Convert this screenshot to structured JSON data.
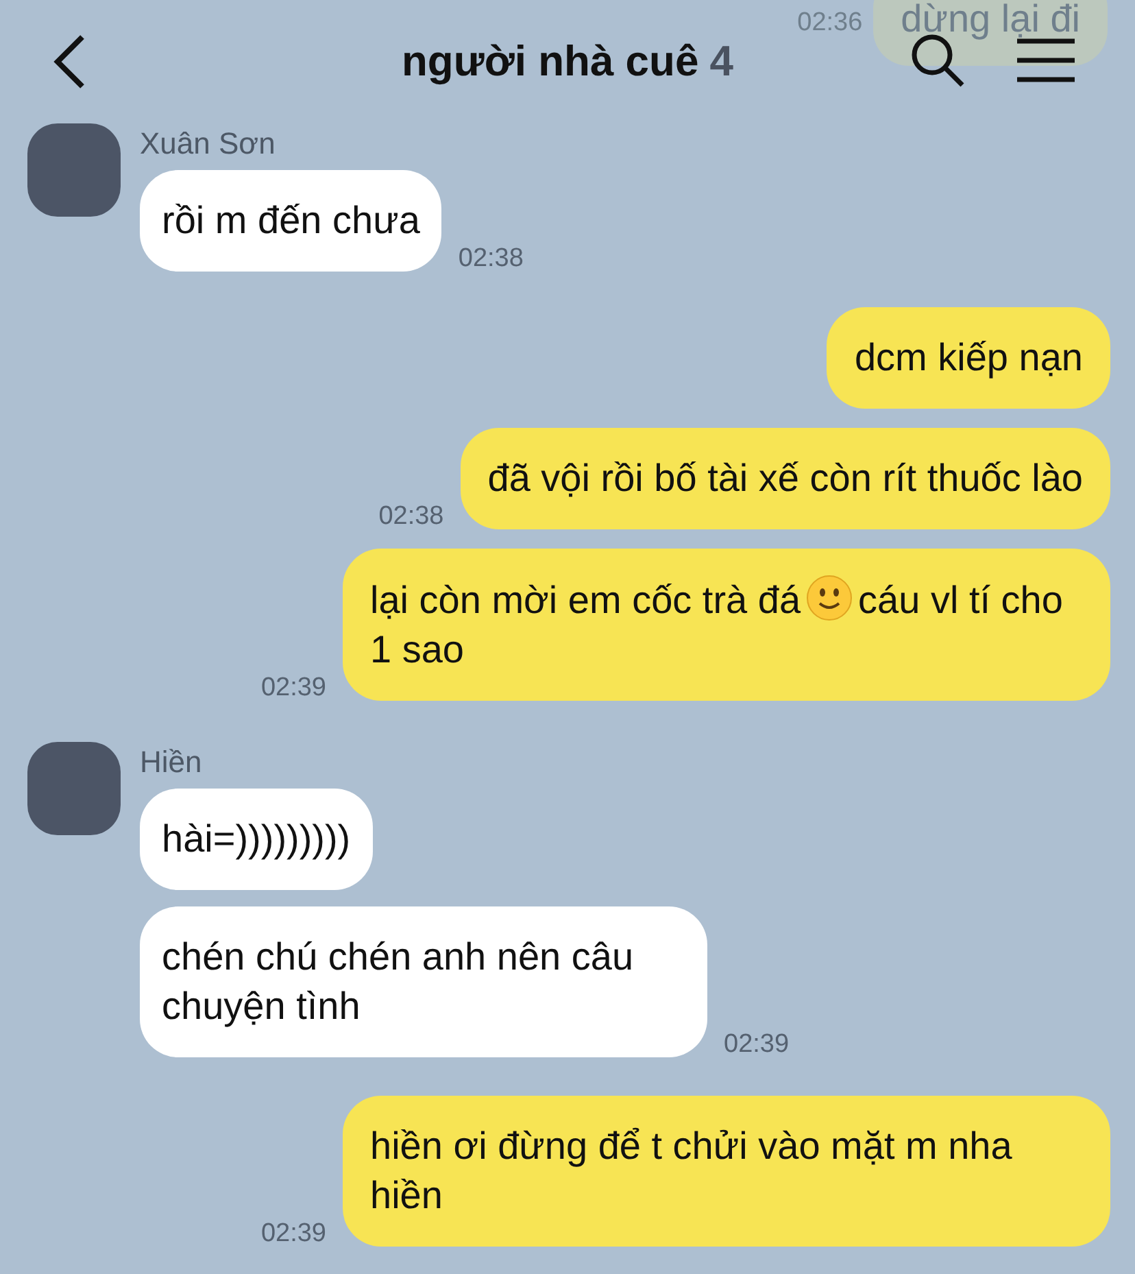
{
  "header": {
    "title": "người nhà cuê",
    "member_count": "4",
    "faded_message": {
      "text": "dừng lại đi",
      "time": "02:36"
    }
  },
  "messages": [
    {
      "kind": "incoming",
      "sender": "Xuân Sơn",
      "bubbles": [
        "rồi m đến chưa"
      ],
      "time": "02:38"
    },
    {
      "kind": "outgoing",
      "parts": [
        "dcm kiếp nạn"
      ]
    },
    {
      "kind": "outgoing",
      "parts": [
        "đã vội rồi bố tài xế còn rít thuốc lào"
      ],
      "time": "02:38"
    },
    {
      "kind": "outgoing",
      "parts": [
        "lại còn mời em cốc trà đá",
        "cáu vl tí cho 1 sao"
      ],
      "time": "02:39"
    },
    {
      "kind": "incoming",
      "sender": "Hiền",
      "bubbles": [
        "hài=)))))))))",
        "chén chú chén anh nên câu chuyện tình"
      ],
      "time": "02:39"
    },
    {
      "kind": "outgoing",
      "parts": [
        "hiền ơi đừng để t chửi vào mặt m nha hiền"
      ],
      "time": "02:39"
    }
  ]
}
